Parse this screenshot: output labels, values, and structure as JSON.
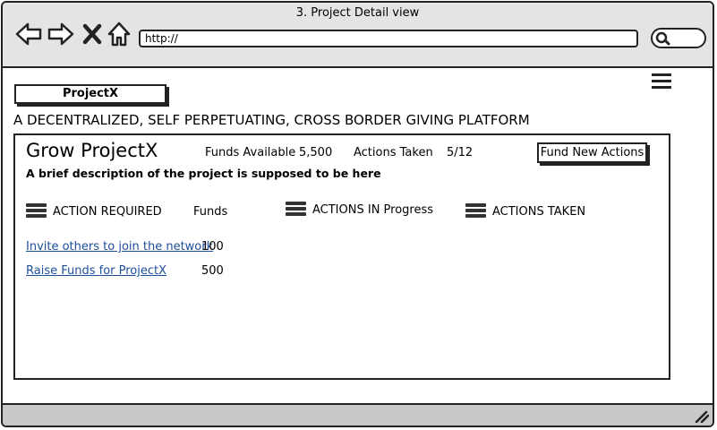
{
  "window": {
    "title": "3. Project Detail view"
  },
  "browser": {
    "url": "http://"
  },
  "app": {
    "logo": "ProjectX",
    "tagline": "A DECENTRALIZED, SELF PERPETUATING, CROSS BORDER GIVING PLATFORM"
  },
  "project": {
    "title": "Grow ProjectX",
    "funds_label": "Funds Available",
    "funds_value": "5,500",
    "actions_label": "Actions Taken",
    "actions_value": "5/12",
    "fund_button": "Fund New Actions",
    "description": "A brief description of the project is supposed to be here"
  },
  "sections": {
    "required": "ACTION REQUIRED",
    "funds_col": "Funds",
    "in_progress": "ACTIONS IN Progress",
    "taken": "ACTIONS TAKEN"
  },
  "actions_required": [
    {
      "label": "Invite others to join the network",
      "funds": "100"
    },
    {
      "label": "Raise Funds for ProjectX",
      "funds": "500"
    }
  ],
  "icons": [
    "back-arrow-icon",
    "forward-arrow-icon",
    "close-icon",
    "home-icon",
    "search-icon",
    "hamburger-menu-icon",
    "list-icon",
    "resize-grip-icon"
  ]
}
